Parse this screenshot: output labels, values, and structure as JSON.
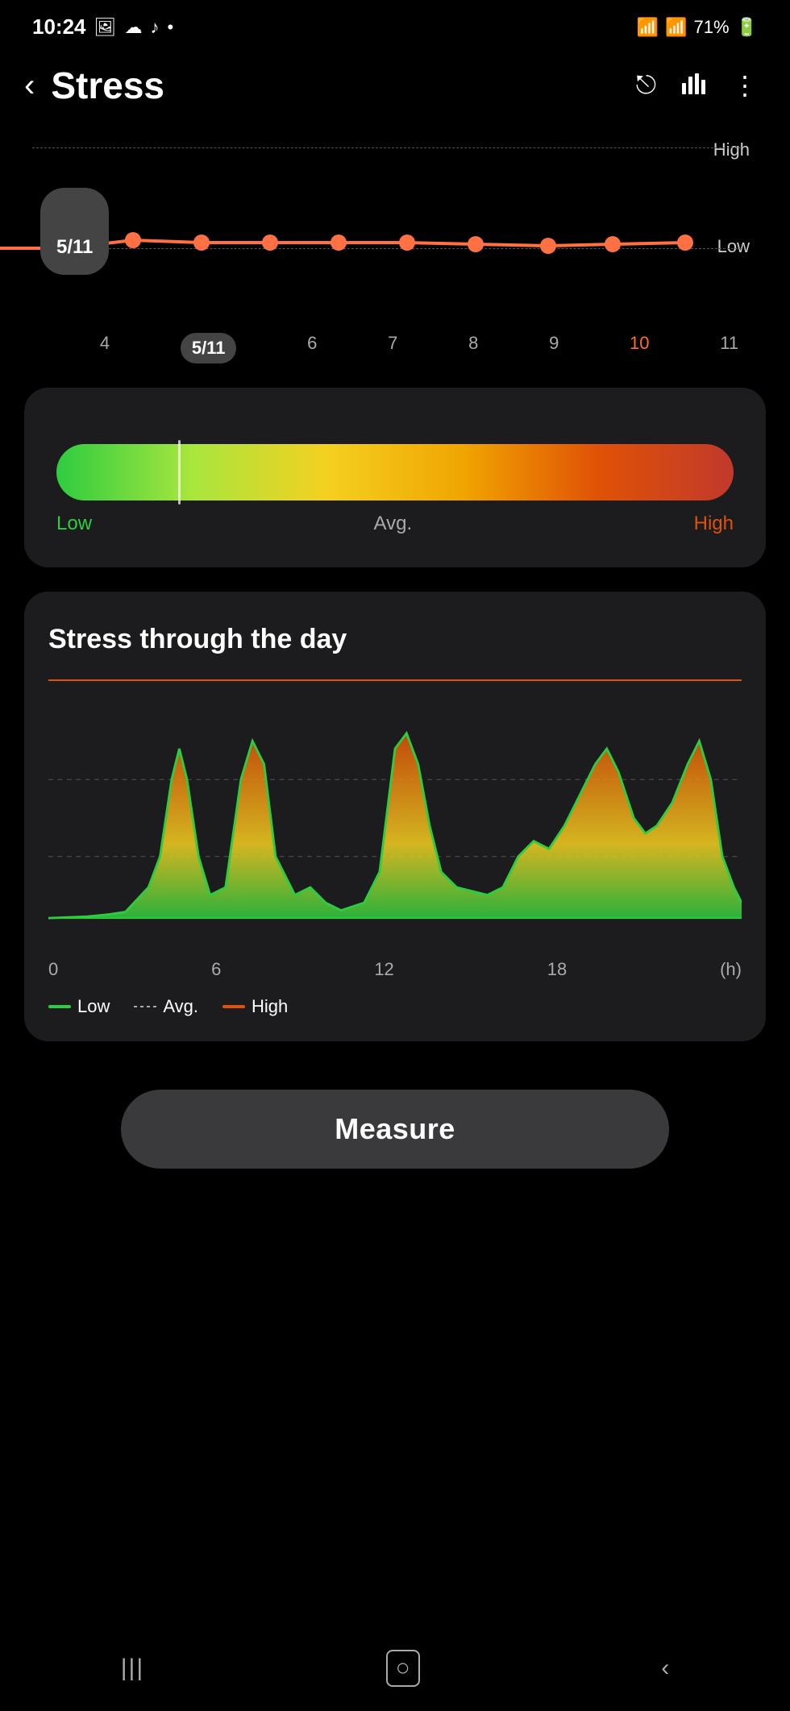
{
  "statusBar": {
    "time": "10:24",
    "battery": "71%",
    "icons": [
      "photo",
      "cloud",
      "person",
      "dot"
    ]
  },
  "header": {
    "back_label": "‹",
    "title": "Stress",
    "shareIcon": "share",
    "chartIcon": "chart",
    "moreIcon": "more"
  },
  "lineChart": {
    "yLabels": [
      "High",
      "Low"
    ],
    "xLabels": [
      "4",
      "5/11",
      "6",
      "7",
      "8",
      "9",
      "10",
      "11"
    ],
    "selectedDate": "5/11",
    "highlightDate": "10"
  },
  "stressCard": {
    "gradientBar": {
      "markerPosition": "18%"
    },
    "labels": {
      "low": "Low",
      "avg": "Avg.",
      "high": "High"
    }
  },
  "stressDayCard": {
    "title": "Stress through the day",
    "xLabels": [
      "0",
      "6",
      "12",
      "18",
      "(h)"
    ],
    "legend": {
      "low": "Low",
      "avg": "Avg.",
      "high": "High"
    }
  },
  "measureButton": {
    "label": "Measure"
  },
  "bottomNav": {
    "icons": [
      "|||",
      "○",
      "‹"
    ]
  }
}
